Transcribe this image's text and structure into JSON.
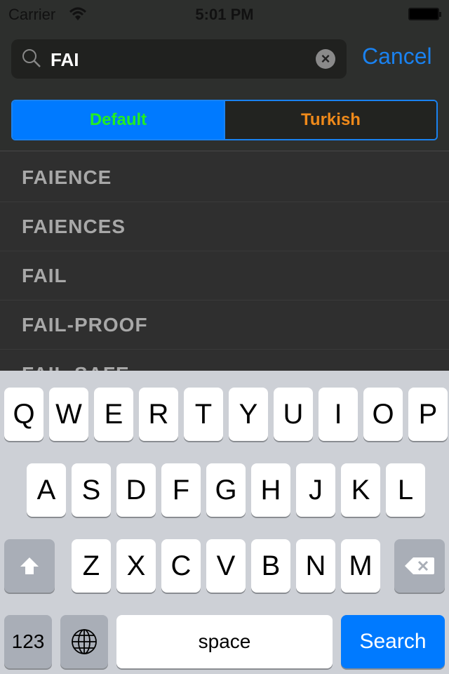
{
  "status": {
    "carrier": "Carrier",
    "time": "5:01 PM"
  },
  "search": {
    "value": "FAI",
    "cancel": "Cancel",
    "icon": "search-icon",
    "clear_icon": "clear-icon"
  },
  "segments": [
    {
      "label": "Default",
      "selected": true
    },
    {
      "label": "Turkish",
      "selected": false
    }
  ],
  "colors": {
    "accent": "#007aff",
    "default_label": "#22ee22",
    "turkish_label": "#f08a1a"
  },
  "results": [
    "FAIENCE",
    "FAIENCES",
    "FAIL",
    "FAIL-PROOF",
    "FAIL-SAFE"
  ],
  "keyboard": {
    "row1": [
      "Q",
      "W",
      "E",
      "R",
      "T",
      "Y",
      "U",
      "I",
      "O",
      "P"
    ],
    "row2": [
      "A",
      "S",
      "D",
      "F",
      "G",
      "H",
      "J",
      "K",
      "L"
    ],
    "row3": [
      "Z",
      "X",
      "C",
      "V",
      "B",
      "N",
      "M"
    ],
    "numbers": "123",
    "space": "space",
    "search": "Search"
  }
}
